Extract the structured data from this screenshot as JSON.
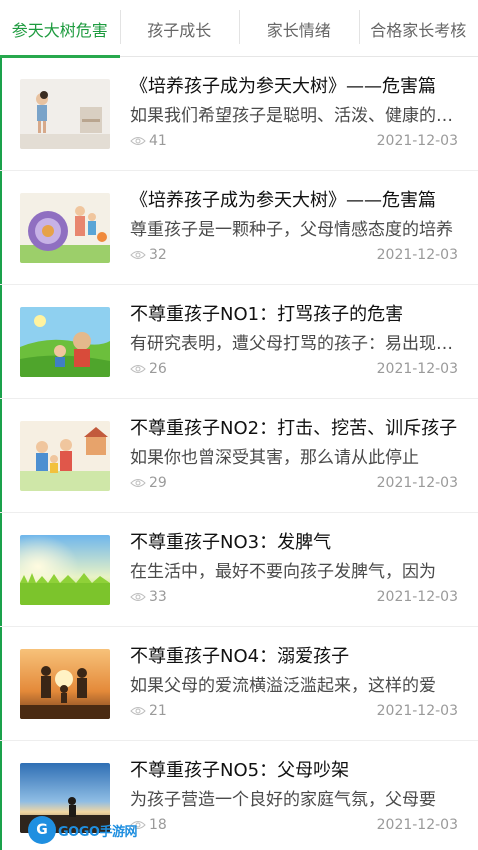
{
  "tabs": [
    {
      "label": "参天大树危害",
      "active": true
    },
    {
      "label": "孩子成长",
      "active": false
    },
    {
      "label": "家长情绪",
      "active": false
    },
    {
      "label": "合格家长考核",
      "active": false
    }
  ],
  "articles": [
    {
      "title": "《培养孩子成为参天大树》——危害篇",
      "summary": "如果我们希望孩子是聪明、活泼、健康的孩子",
      "views": "41",
      "date": "2021-12-03"
    },
    {
      "title": "《培养孩子成为参天大树》——危害篇",
      "summary": "尊重孩子是一颗种子，父母情感态度的培养",
      "views": "32",
      "date": "2021-12-03"
    },
    {
      "title": "不尊重孩子NO1：打骂孩子的危害",
      "summary": "有研究表明，遭父母打骂的孩子：易出现问题",
      "views": "26",
      "date": "2021-12-03"
    },
    {
      "title": "不尊重孩子NO2：打击、挖苦、训斥孩子",
      "summary": "如果你也曾深受其害，那么请从此停止",
      "views": "29",
      "date": "2021-12-03"
    },
    {
      "title": "不尊重孩子NO3：发脾气",
      "summary": "在生活中，最好不要向孩子发脾气，因为",
      "views": "33",
      "date": "2021-12-03"
    },
    {
      "title": "不尊重孩子NO4：溺爱孩子",
      "summary": "如果父母的爱流横溢泛滥起来，这样的爱",
      "views": "21",
      "date": "2021-12-03"
    },
    {
      "title": " 不尊重孩子NO5：父母吵架",
      "summary": "为孩子营造一个良好的家庭气氛，父母要",
      "views": "18",
      "date": "2021-12-03"
    }
  ],
  "watermark": {
    "text": "GOGO手游网"
  },
  "colors": {
    "accent": "#27a84d",
    "muted": "#9a9a9a"
  },
  "icons": {
    "views": "eye-icon"
  }
}
